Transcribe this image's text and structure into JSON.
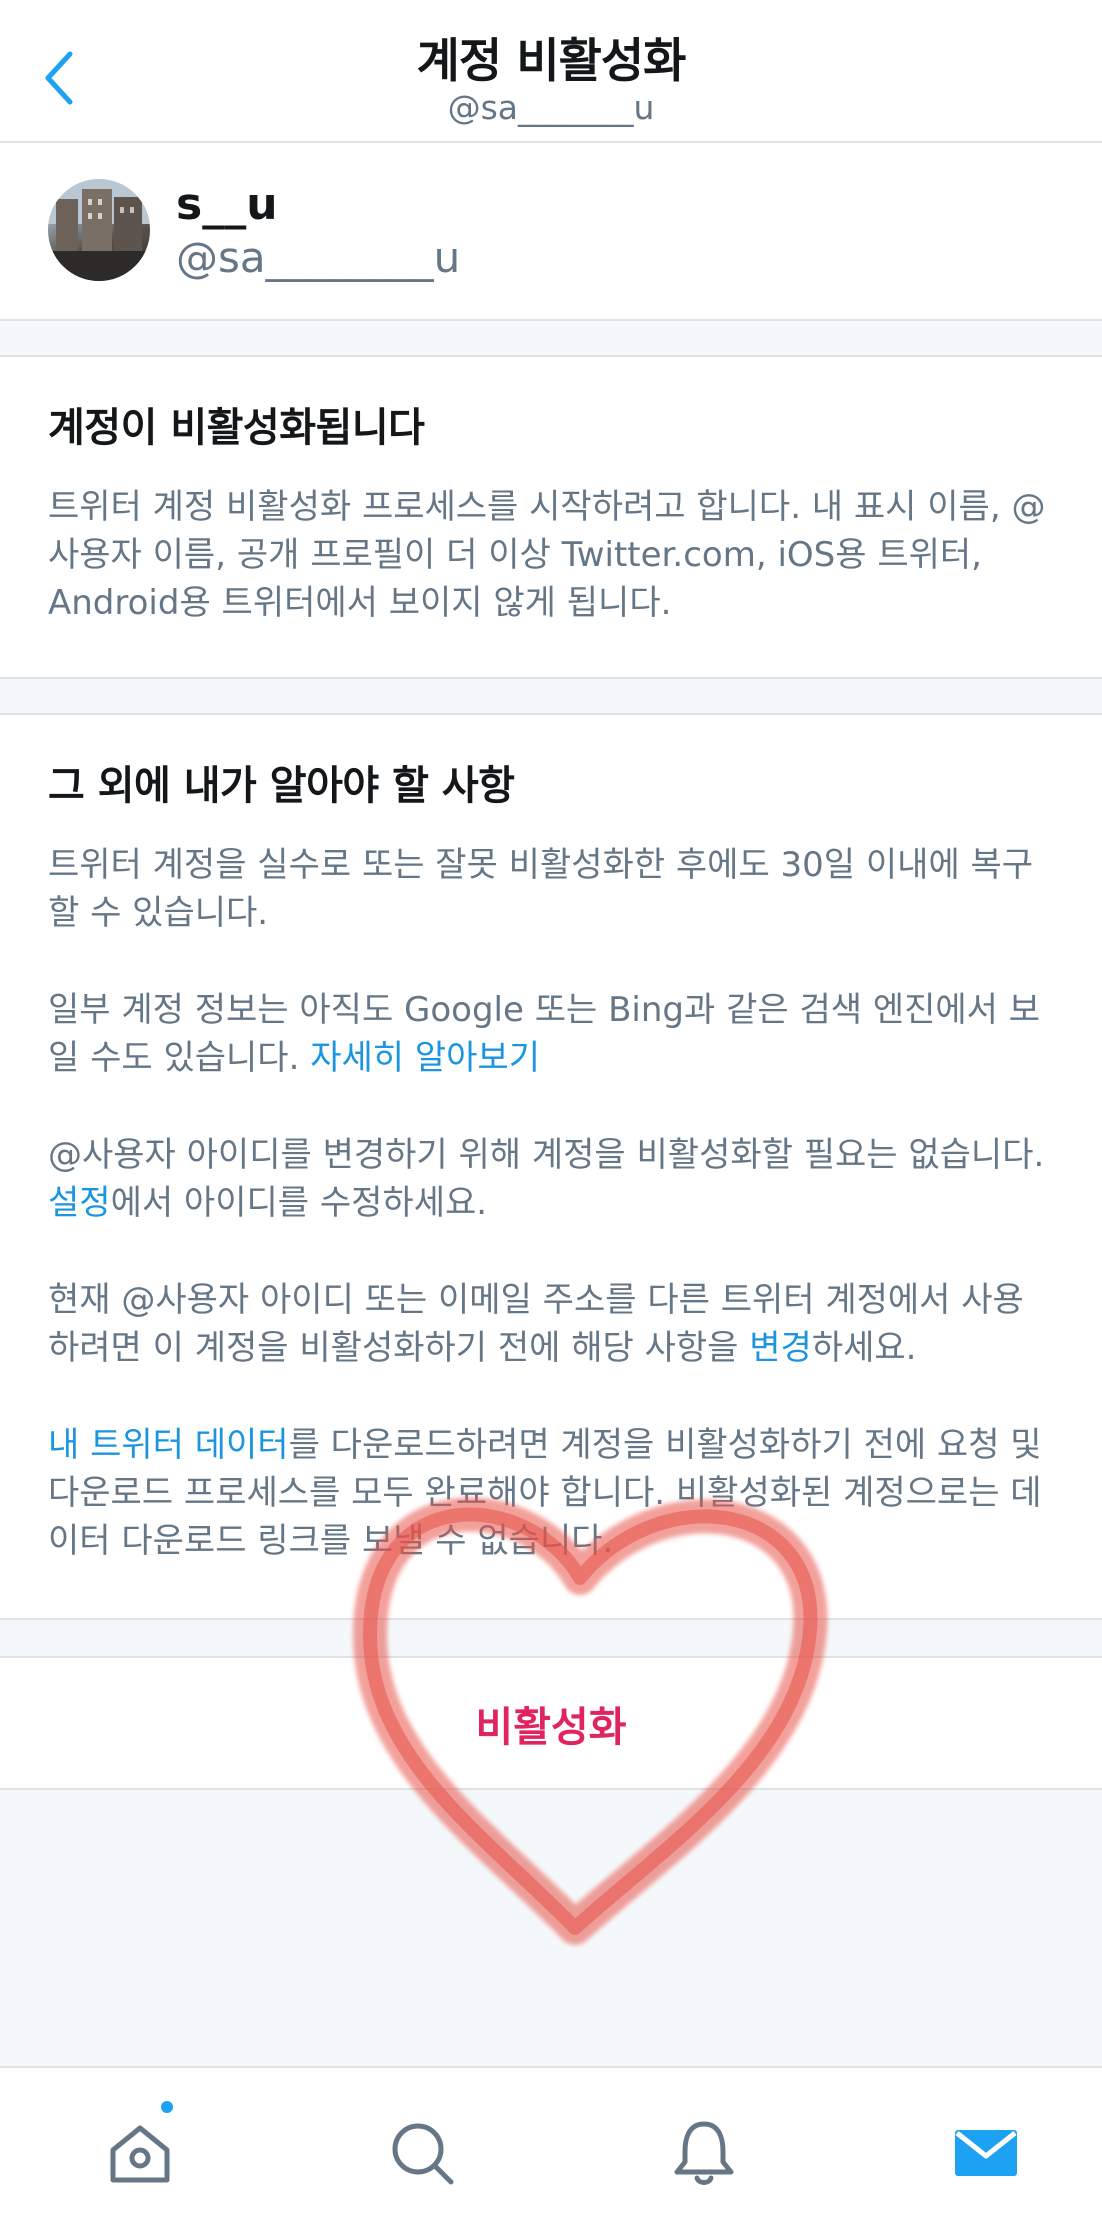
{
  "header": {
    "title": "계정 비활성화",
    "subtitle": "@sa_______u"
  },
  "profile": {
    "display_name": "s__u",
    "handle": "@sa________u"
  },
  "section1": {
    "heading": "계정이 비활성화됩니다",
    "body": "트위터 계정 비활성화 프로세스를 시작하려고 합니다. 내 표시 이름, @사용자 이름, 공개 프로필이 더 이상 Twitter.com, iOS용 트위터, Android용 트위터에서 보이지 않게 됩니다."
  },
  "section2": {
    "heading": "그 외에 내가 알아야 할 사항",
    "p1": "트위터 계정을 실수로 또는 잘못 비활성화한 후에도 30일 이내에 복구할 수 있습니다.",
    "p2_text": "일부 계정 정보는 아직도 Google 또는 Bing과 같은 검색 엔진에서 보일 수도 있습니다.",
    "p2_link": "자세히 알아보기",
    "p3_before": "@사용자 아이디를 변경하기 위해 계정을 비활성화할 필요는 없습니다.",
    "p3_link": "설정",
    "p3_after": "에서 아이디를 수정하세요.",
    "p4_before": "현재 @사용자 아이디 또는 이메일 주소를 다른 트위터 계정에서 사용하려면 이 계정을 비활성화하기 전에 해당 사항을 ",
    "p4_link": "변경",
    "p4_after": "하세요.",
    "p5_link": "내 트위터 데이터",
    "p5_after": "를 다운로드하려면 계정을 비활성화하기 전에 요청 및 다운로드 프로세스를 모두 완료해야 합니다. 비활성화된 계정으로는 데이터 다운로드 링크를 보낼 수 없습니다."
  },
  "deactivate_button": "비활성화",
  "tabbar": {
    "icons": [
      "home-icon",
      "search-icon",
      "notifications-icon",
      "messages-icon"
    ],
    "home_badge": true
  },
  "colors": {
    "accent": "#1da1f2",
    "link": "#1b95e0",
    "danger": "#e0245e",
    "heart": "#e8524a"
  }
}
